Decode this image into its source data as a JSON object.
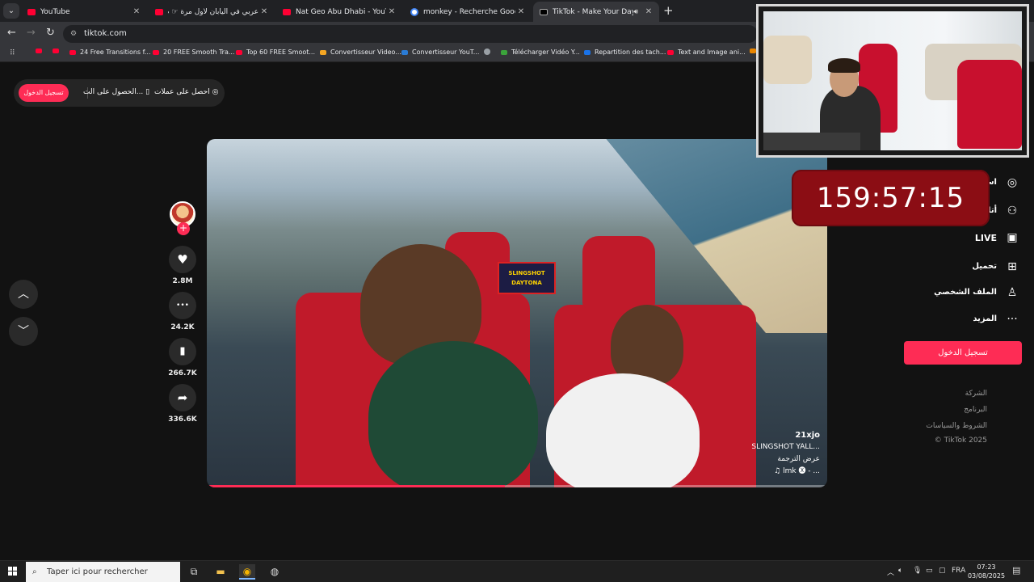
{
  "browser": {
    "tabs": [
      {
        "title": "YouTube",
        "icon": "youtube-icon"
      },
      {
        "title": "عربي في اليابان لأول مرة ☞ صد...",
        "icon": "youtube-icon"
      },
      {
        "title": "Nat Geo Abu Dhabi - YouTube",
        "icon": "youtube-icon"
      },
      {
        "title": "monkey - Recherche Google",
        "icon": "google-icon"
      },
      {
        "title": "TikTok - Make Your Day",
        "icon": "tiktok-icon",
        "active": true
      }
    ],
    "address": "tiktok.com",
    "bookmarks": [
      "",
      "",
      "24 Free Transitions f...",
      "20 FREE Smooth Tra...",
      "Top 60 FREE Smoot...",
      "Convertisseur Video...",
      "Convertisseur YouT...",
      "",
      "Télécharger Vidéo Y...",
      "Repartition des tach...",
      "Text and Image ani..."
    ]
  },
  "tiktok": {
    "top_login": "تسجيل الدخول",
    "top_app": "الحصول على الت...",
    "top_coins": "احصل على عملات",
    "video": {
      "sign_text": "SLINGSHOT DAYTONA",
      "progress": 0.48,
      "username": "21xjo",
      "description": "SLINGSHOT YALL...",
      "translate": "عرض الترجمة",
      "sound": "♫ lmk 🅧 - ..."
    },
    "actions": [
      {
        "name": "like",
        "icon": "♥",
        "count": "2.8M"
      },
      {
        "name": "comment",
        "icon": "•••",
        "count": "24.2K"
      },
      {
        "name": "save",
        "icon": "▮",
        "count": "266.7K"
      },
      {
        "name": "share",
        "icon": "➦",
        "count": "336.6K"
      }
    ],
    "sidebar": [
      {
        "label": "است",
        "icon": "compass-icon"
      },
      {
        "label": "أتا",
        "icon": "user-plus-icon"
      },
      {
        "label": "LIVE",
        "icon": "live-icon"
      },
      {
        "label": "تحميل",
        "icon": "upload-icon"
      },
      {
        "label": "الملف الشخصي",
        "icon": "profile-icon"
      },
      {
        "label": "المزيد",
        "icon": "more-icon"
      }
    ],
    "sidebar_login": "تسجيل الدخول",
    "footer": [
      "الشركة",
      "البرنامج",
      "الشروط والسياسات",
      "© TikTok 2025"
    ]
  },
  "overlay": {
    "timer": "159:57:15"
  },
  "taskbar": {
    "search_placeholder": "Taper ici pour rechercher",
    "language": "FRA",
    "time": "07:23",
    "date": "03/08/2025"
  },
  "colors": {
    "tiktok_red": "#fe2c55",
    "timer_bg": "#8b0d14"
  }
}
